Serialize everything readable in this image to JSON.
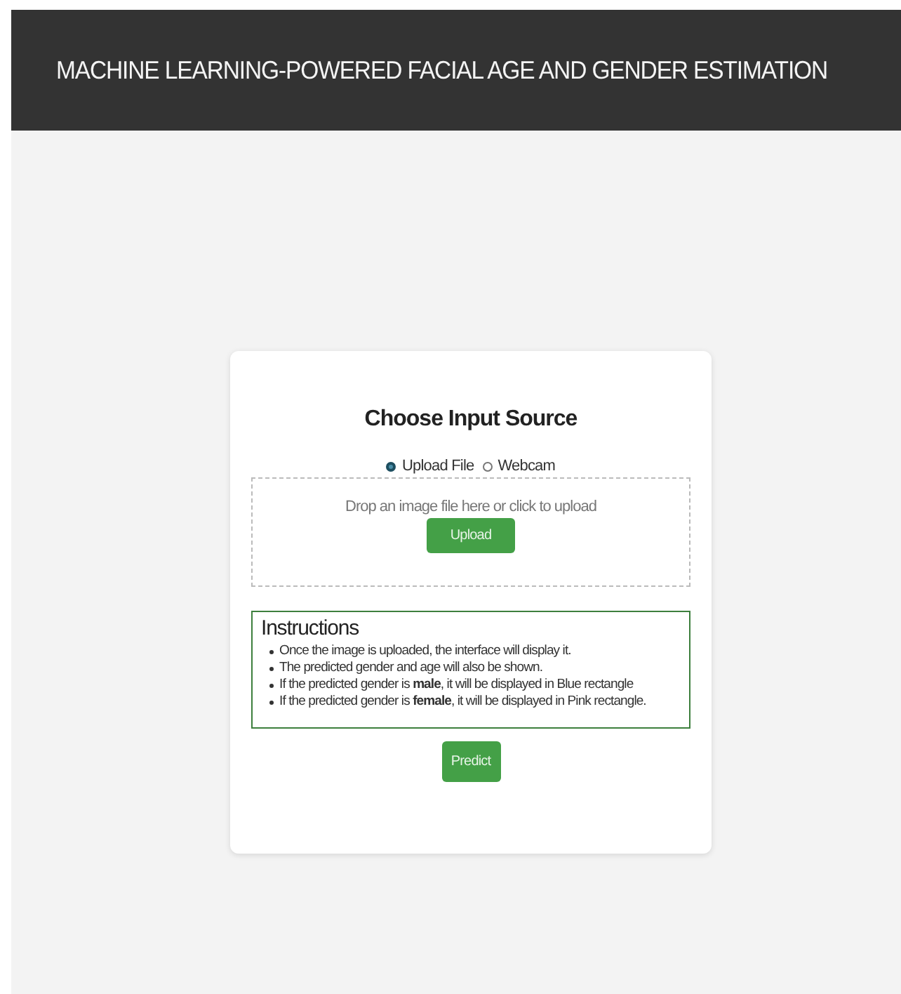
{
  "header": {
    "title": "MACHINE LEARNING-POWERED FACIAL AGE AND GENDER ESTIMATION"
  },
  "card": {
    "title": "Choose Input Source",
    "sources": [
      {
        "label": "Upload File",
        "selected": true
      },
      {
        "label": "Webcam",
        "selected": false
      }
    ],
    "dropzone": {
      "hint": "Drop an image file here or click to upload",
      "button": "Upload"
    },
    "instructions": {
      "title": "Instructions",
      "items": [
        "Once the image is uploaded, the interface will display it.",
        "The predicted gender and age will also be shown.",
        "If the predicted gender is **male**, it will be displayed in Blue rectangle",
        "If the predicted gender is **female**, it will be displayed in Pink rectangle."
      ]
    },
    "predict_button": "Predict"
  }
}
